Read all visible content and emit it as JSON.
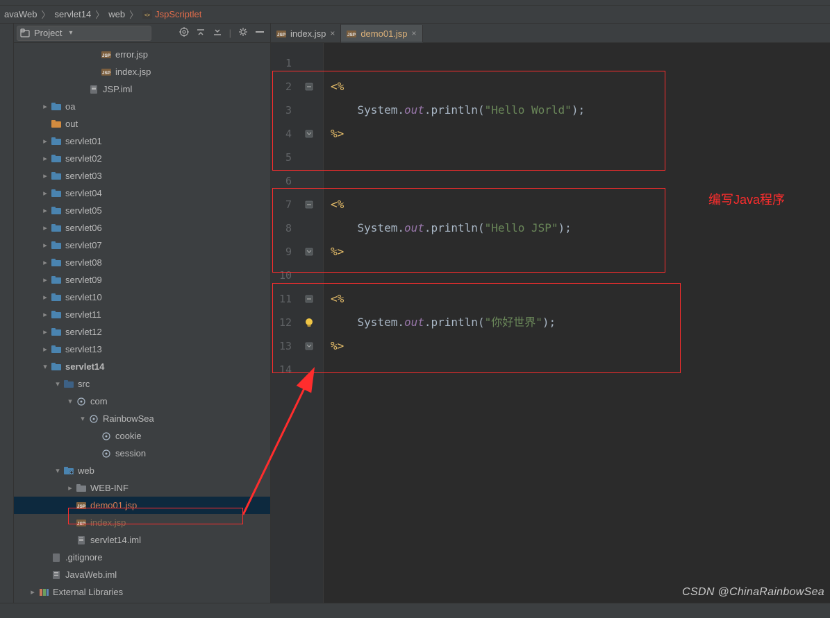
{
  "breadcrumb": {
    "items": [
      "avaWeb",
      "servlet14",
      "web",
      "JspScriptlet"
    ],
    "active_index": 3,
    "jsp_icon": true
  },
  "project_panel": {
    "title": "Project",
    "tool_icons": [
      "target-icon",
      "collapse-icon",
      "expand-icon",
      "divider",
      "gear-icon",
      "hide-icon"
    ]
  },
  "tree": [
    {
      "indent": 5,
      "arrow": "none",
      "icon": "jsp",
      "label": "error.jsp"
    },
    {
      "indent": 5,
      "arrow": "none",
      "icon": "jsp",
      "label": "index.jsp"
    },
    {
      "indent": 4,
      "arrow": "none",
      "icon": "iml",
      "label": "JSP.iml"
    },
    {
      "indent": 1,
      "arrow": "right",
      "icon": "folder",
      "label": "oa"
    },
    {
      "indent": 1,
      "arrow": "none",
      "icon": "folder-o",
      "label": "out"
    },
    {
      "indent": 1,
      "arrow": "right",
      "icon": "folder",
      "label": "servlet01"
    },
    {
      "indent": 1,
      "arrow": "right",
      "icon": "folder",
      "label": "servlet02"
    },
    {
      "indent": 1,
      "arrow": "right",
      "icon": "folder",
      "label": "servlet03"
    },
    {
      "indent": 1,
      "arrow": "right",
      "icon": "folder",
      "label": "servlet04"
    },
    {
      "indent": 1,
      "arrow": "right",
      "icon": "folder",
      "label": "servlet05"
    },
    {
      "indent": 1,
      "arrow": "right",
      "icon": "folder",
      "label": "servlet06"
    },
    {
      "indent": 1,
      "arrow": "right",
      "icon": "folder",
      "label": "servlet07"
    },
    {
      "indent": 1,
      "arrow": "right",
      "icon": "folder",
      "label": "servlet08"
    },
    {
      "indent": 1,
      "arrow": "right",
      "icon": "folder",
      "label": "servlet09"
    },
    {
      "indent": 1,
      "arrow": "right",
      "icon": "folder",
      "label": "servlet10"
    },
    {
      "indent": 1,
      "arrow": "right",
      "icon": "folder",
      "label": "servlet11"
    },
    {
      "indent": 1,
      "arrow": "right",
      "icon": "folder",
      "label": "servlet12"
    },
    {
      "indent": 1,
      "arrow": "right",
      "icon": "folder",
      "label": "servlet13"
    },
    {
      "indent": 1,
      "arrow": "down",
      "icon": "folder",
      "label": "servlet14",
      "bold": true
    },
    {
      "indent": 2,
      "arrow": "down",
      "icon": "src",
      "label": "src"
    },
    {
      "indent": 3,
      "arrow": "down",
      "icon": "pkg",
      "label": "com"
    },
    {
      "indent": 4,
      "arrow": "down",
      "icon": "pkg",
      "label": "RainbowSea"
    },
    {
      "indent": 5,
      "arrow": "none",
      "icon": "pkg",
      "label": "cookie"
    },
    {
      "indent": 5,
      "arrow": "none",
      "icon": "pkg",
      "label": "session"
    },
    {
      "indent": 2,
      "arrow": "down",
      "icon": "webfolder",
      "label": "web"
    },
    {
      "indent": 3,
      "arrow": "right",
      "icon": "folder-d",
      "label": "WEB-INF"
    },
    {
      "indent": 3,
      "arrow": "none",
      "icon": "jsp",
      "label": "demo01.jsp",
      "selected": true,
      "active": true
    },
    {
      "indent": 3,
      "arrow": "none",
      "icon": "jsp",
      "label": "index.jsp",
      "dim": true
    },
    {
      "indent": 3,
      "arrow": "none",
      "icon": "iml",
      "label": "servlet14.iml"
    },
    {
      "indent": 1,
      "arrow": "none",
      "icon": "git",
      "label": ".gitignore"
    },
    {
      "indent": 1,
      "arrow": "none",
      "icon": "iml",
      "label": "JavaWeb.iml"
    },
    {
      "indent": 0,
      "arrow": "right",
      "icon": "lib",
      "label": "External Libraries"
    },
    {
      "indent": 0,
      "arrow": "right",
      "icon": "scratch",
      "label": ""
    }
  ],
  "editor": {
    "tabs": [
      {
        "label": "index.jsp",
        "active": false
      },
      {
        "label": "demo01.jsp",
        "active": true
      }
    ],
    "lines": [
      {
        "n": 1,
        "tokens": []
      },
      {
        "n": 2,
        "tokens": [
          {
            "t": "tag",
            "v": "<%"
          }
        ],
        "fold": "open"
      },
      {
        "n": 3,
        "tokens": [
          {
            "t": "plain",
            "v": "    System."
          },
          {
            "t": "field",
            "v": "out"
          },
          {
            "t": "plain",
            "v": ".println("
          },
          {
            "t": "str",
            "v": "\"Hello World\""
          },
          {
            "t": "plain",
            "v": ");"
          }
        ]
      },
      {
        "n": 4,
        "tokens": [
          {
            "t": "tag",
            "v": "%>"
          }
        ],
        "fold": "close"
      },
      {
        "n": 5,
        "tokens": []
      },
      {
        "n": 6,
        "tokens": []
      },
      {
        "n": 7,
        "tokens": [
          {
            "t": "tag",
            "v": "<%"
          }
        ],
        "fold": "open"
      },
      {
        "n": 8,
        "tokens": [
          {
            "t": "plain",
            "v": "    System."
          },
          {
            "t": "field",
            "v": "out"
          },
          {
            "t": "plain",
            "v": ".println("
          },
          {
            "t": "str",
            "v": "\"Hello JSP\""
          },
          {
            "t": "plain",
            "v": ");"
          }
        ]
      },
      {
        "n": 9,
        "tokens": [
          {
            "t": "tag",
            "v": "%>"
          }
        ],
        "fold": "close"
      },
      {
        "n": 10,
        "tokens": []
      },
      {
        "n": 11,
        "tokens": [
          {
            "t": "tag",
            "v": "<%"
          }
        ],
        "fold": "open"
      },
      {
        "n": 12,
        "tokens": [
          {
            "t": "plain",
            "v": "    System."
          },
          {
            "t": "field",
            "v": "out"
          },
          {
            "t": "plain",
            "v": ".println("
          },
          {
            "t": "str",
            "v": "\"你好世界\""
          },
          {
            "t": "plain",
            "v": ");"
          }
        ],
        "bulb": true
      },
      {
        "n": 13,
        "tokens": [
          {
            "t": "tag",
            "v": "%>"
          }
        ],
        "fold": "close"
      },
      {
        "n": 14,
        "tokens": []
      }
    ]
  },
  "annotation": "编写Java程序",
  "watermark": "CSDN @ChinaRainbowSea"
}
